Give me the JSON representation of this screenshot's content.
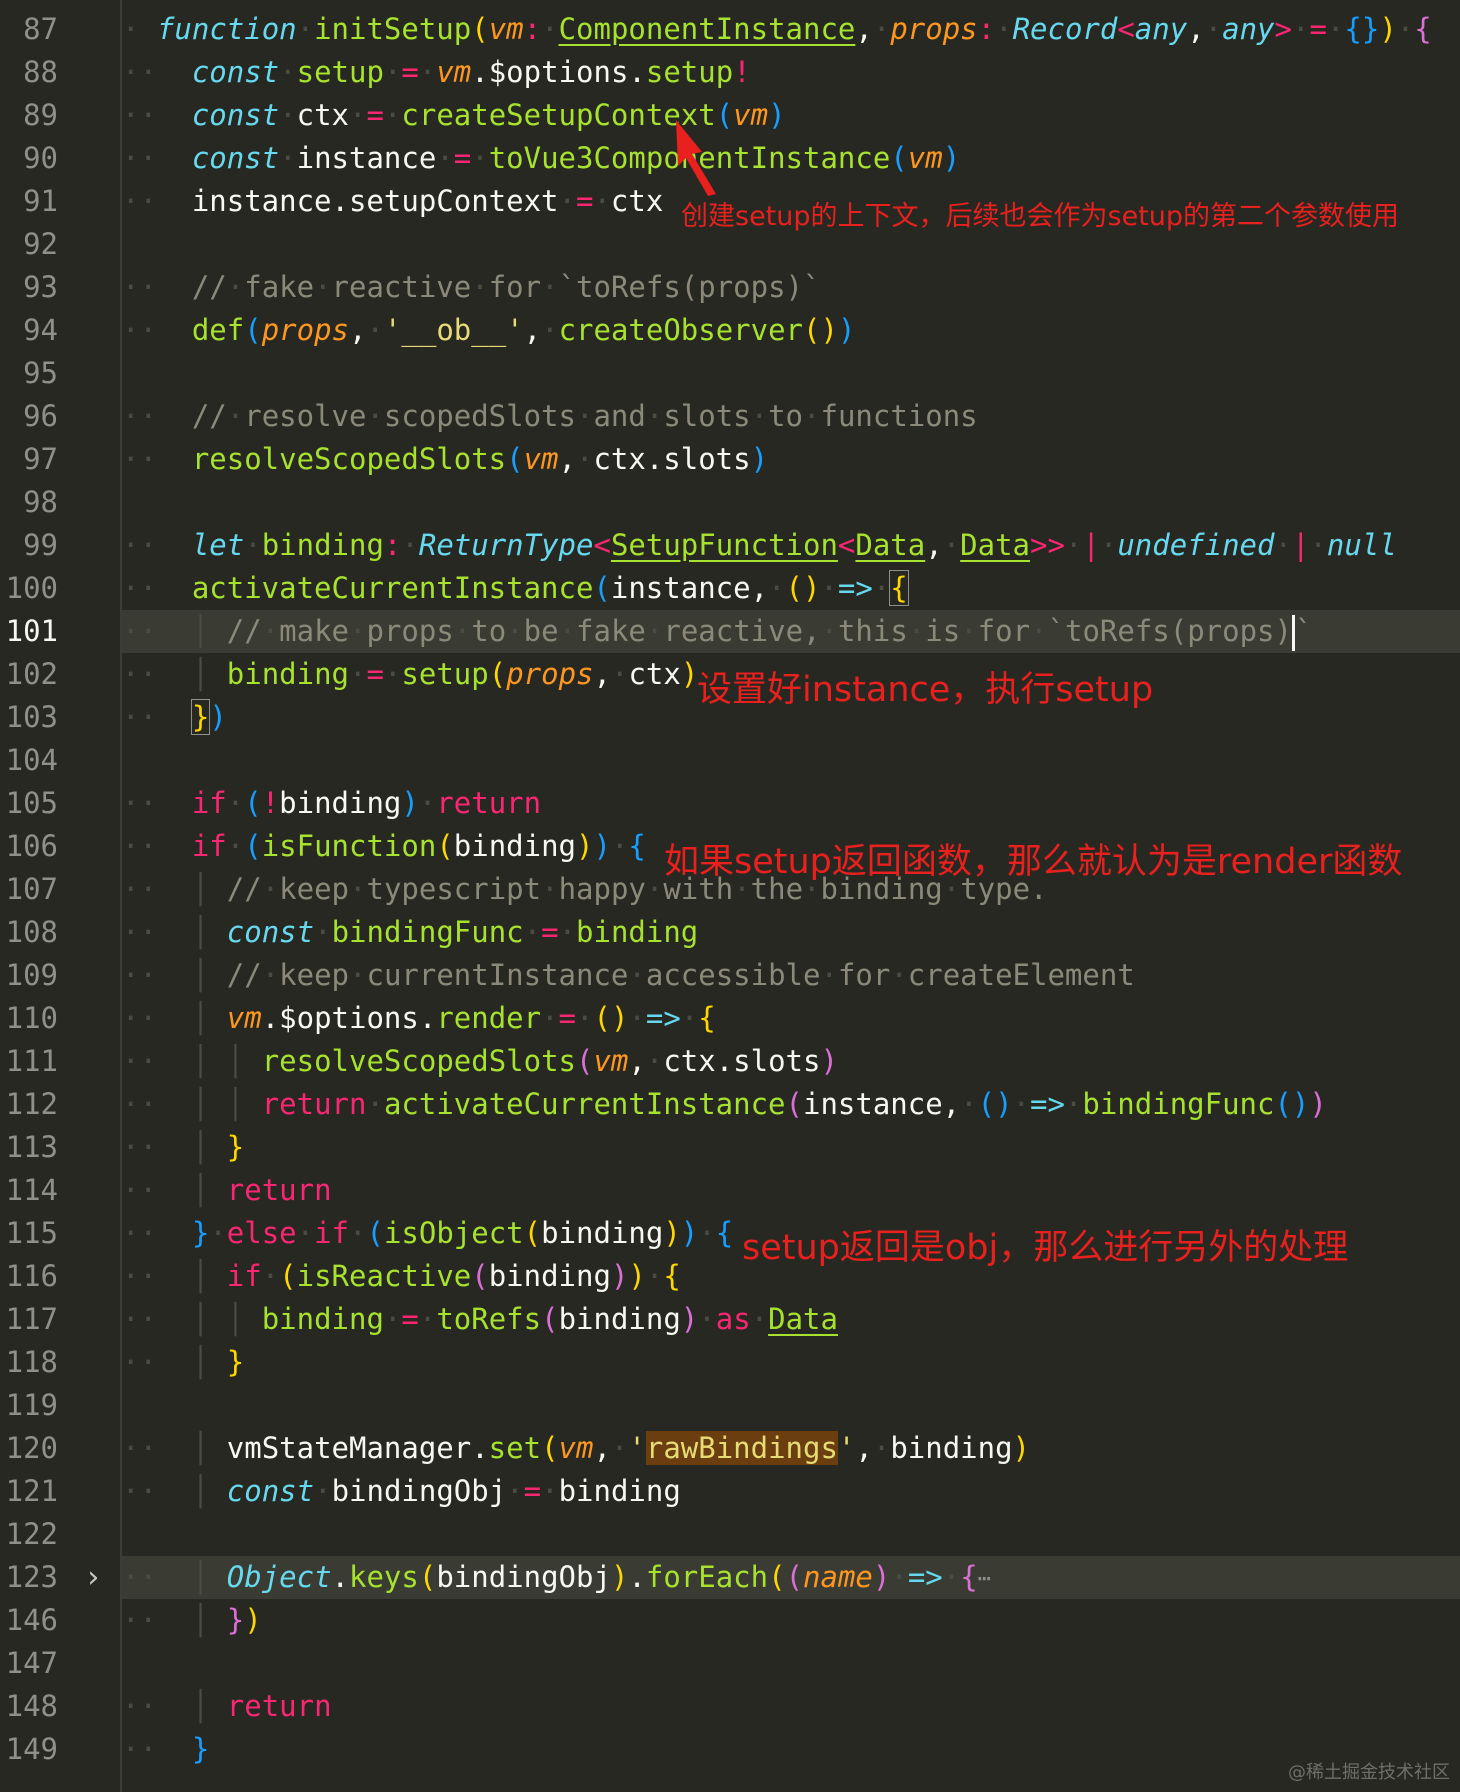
{
  "editor": {
    "theme_colors": {
      "background": "#272822",
      "keyword": "#66d9ef",
      "control": "#f92672",
      "function": "#a6e22e",
      "param": "#fd971f",
      "string": "#e6db74",
      "comment": "#8b8a7a",
      "annotation": "#e8201e"
    },
    "lines": [
      {
        "num": "87",
        "code": "function initSetup(vm: ComponentInstance, props: Record<any, any> = {}) {"
      },
      {
        "num": "88",
        "code": "  const setup = vm.$options.setup!"
      },
      {
        "num": "89",
        "code": "  const ctx = createSetupContext(vm)"
      },
      {
        "num": "90",
        "code": "  const instance = toVue3ComponentInstance(vm)"
      },
      {
        "num": "91",
        "code": "  instance.setupContext = ctx"
      },
      {
        "num": "92",
        "code": ""
      },
      {
        "num": "93",
        "code": "  // fake reactive for `toRefs(props)`"
      },
      {
        "num": "94",
        "code": "  def(props, '__ob__', createObserver())"
      },
      {
        "num": "95",
        "code": ""
      },
      {
        "num": "96",
        "code": "  // resolve scopedSlots and slots to functions"
      },
      {
        "num": "97",
        "code": "  resolveScopedSlots(vm, ctx.slots)"
      },
      {
        "num": "98",
        "code": ""
      },
      {
        "num": "99",
        "code": "  let binding: ReturnType<SetupFunction<Data, Data>> | undefined | null"
      },
      {
        "num": "100",
        "code": "  activateCurrentInstance(instance, () => {"
      },
      {
        "num": "101",
        "code": "    // make props to be fake reactive, this is for `toRefs(props)`"
      },
      {
        "num": "102",
        "code": "    binding = setup(props, ctx)"
      },
      {
        "num": "103",
        "code": "  })"
      },
      {
        "num": "104",
        "code": ""
      },
      {
        "num": "105",
        "code": "  if (!binding) return"
      },
      {
        "num": "106",
        "code": "  if (isFunction(binding)) {"
      },
      {
        "num": "107",
        "code": "    // keep typescript happy with the binding type."
      },
      {
        "num": "108",
        "code": "    const bindingFunc = binding"
      },
      {
        "num": "109",
        "code": "    // keep currentInstance accessible for createElement"
      },
      {
        "num": "110",
        "code": "    vm.$options.render = () => {"
      },
      {
        "num": "111",
        "code": "      resolveScopedSlots(vm, ctx.slots)"
      },
      {
        "num": "112",
        "code": "      return activateCurrentInstance(instance, () => bindingFunc())"
      },
      {
        "num": "113",
        "code": "    }"
      },
      {
        "num": "114",
        "code": "    return"
      },
      {
        "num": "115",
        "code": "  } else if (isObject(binding)) {"
      },
      {
        "num": "116",
        "code": "    if (isReactive(binding)) {"
      },
      {
        "num": "117",
        "code": "      binding = toRefs(binding) as Data"
      },
      {
        "num": "118",
        "code": "    }"
      },
      {
        "num": "119",
        "code": ""
      },
      {
        "num": "120",
        "code": "    vmStateManager.set(vm, 'rawBindings', binding)"
      },
      {
        "num": "121",
        "code": "    const bindingObj = binding"
      },
      {
        "num": "122",
        "code": ""
      },
      {
        "num": "123",
        "code": "    Object.keys(bindingObj).forEach((name) => {"
      },
      {
        "num": "146",
        "code": "    })"
      },
      {
        "num": "147",
        "code": ""
      },
      {
        "num": "148",
        "code": "    return"
      },
      {
        "num": "149",
        "code": "  }"
      }
    ],
    "fold_icon": "chevron-right-icon",
    "folded_ellipsis": "⋯"
  },
  "annotations": [
    {
      "text": "创建setup的上下文，后续也会作为setup的第二个参数使用"
    },
    {
      "text": "设置好instance，执行setup"
    },
    {
      "text": "如果setup返回函数，那么就认为是render函数"
    },
    {
      "text": "setup返回是obj，那么进行另外的处理"
    }
  ],
  "watermark": "@稀土掘金技术社区"
}
